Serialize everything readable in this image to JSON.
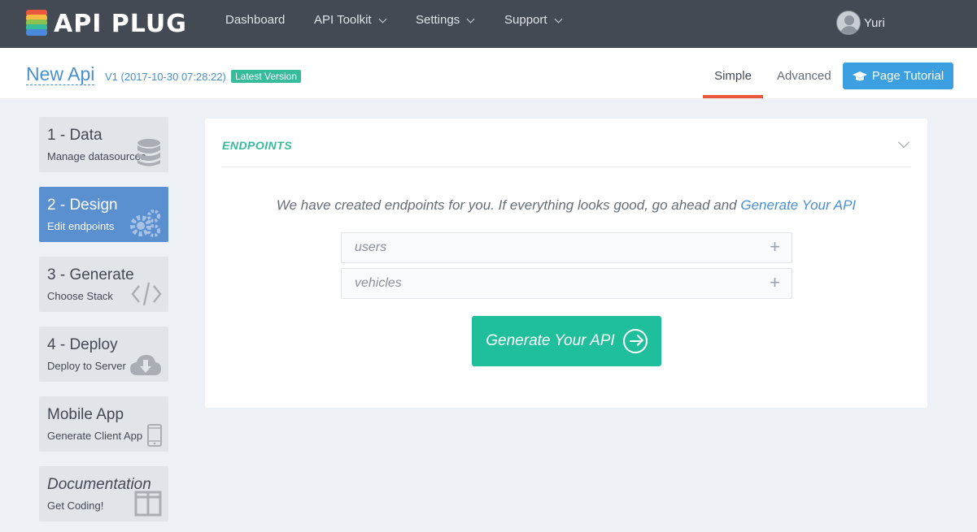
{
  "app": {
    "logo_text": "API PLUG"
  },
  "nav": {
    "items": [
      {
        "label": "Dashboard",
        "has_dropdown": false
      },
      {
        "label": "API Toolkit",
        "has_dropdown": true
      },
      {
        "label": "Settings",
        "has_dropdown": true
      },
      {
        "label": "Support",
        "has_dropdown": true
      }
    ],
    "user_name": "Yuri"
  },
  "header": {
    "api_name": "New Api",
    "version": "V1 (2017-10-30 07:28:22)",
    "version_badge": "Latest Version",
    "tabs": [
      {
        "label": "Simple",
        "active": true
      },
      {
        "label": "Advanced",
        "active": false
      }
    ],
    "tutorial_button": "Page Tutorial"
  },
  "steps": [
    {
      "title": "1 - Data",
      "subtitle": "Manage datasources",
      "icon": "database-icon",
      "active": false
    },
    {
      "title": "2 - Design",
      "subtitle": "Edit endpoints",
      "icon": "gears-icon",
      "active": true
    },
    {
      "title": "3 - Generate",
      "subtitle": "Choose Stack",
      "icon": "code-icon",
      "active": false
    },
    {
      "title": "4 - Deploy",
      "subtitle": "Deploy to Server",
      "icon": "cloud-download-icon",
      "active": false
    },
    {
      "title": "Mobile App",
      "subtitle": "Generate Client App",
      "icon": "mobile-icon",
      "active": false
    },
    {
      "title": "Documentation",
      "subtitle": "Get Coding!",
      "icon": "columns-icon",
      "active": false
    }
  ],
  "panel": {
    "title": "ENDPOINTS",
    "intro_text": "We have created endpoints for you. If everything looks good, go ahead and",
    "intro_link": "Generate Your API",
    "endpoints": [
      {
        "name": "users"
      },
      {
        "name": "vehicles"
      }
    ],
    "generate_button": "Generate Your API"
  },
  "colors": {
    "topnav_bg": "#434a54",
    "accent_teal": "#37bc9b",
    "accent_blue": "#4a8fd0",
    "active_step": "#5a8fd0",
    "tab_underline": "#e9573f",
    "generate_button": "#1fbf9b",
    "page_bg": "#edf1f5"
  }
}
